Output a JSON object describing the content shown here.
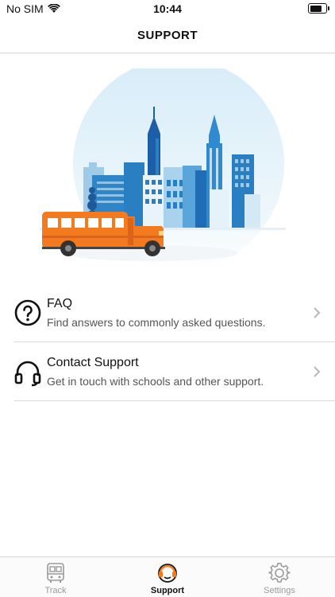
{
  "status_bar": {
    "carrier": "No SIM",
    "time": "10:44",
    "battery_level": 0.85
  },
  "nav": {
    "title": "SUPPORT"
  },
  "list": [
    {
      "title": "FAQ",
      "subtitle": "Find answers to commonly asked questions.",
      "icon": "question-circle-icon"
    },
    {
      "title": "Contact Support",
      "subtitle": "Get in touch with schools and other support.",
      "icon": "headset-icon"
    }
  ],
  "tabs": [
    {
      "label": "Track",
      "icon": "bus-icon",
      "active": false
    },
    {
      "label": "Support",
      "icon": "support-headset-icon",
      "active": true
    },
    {
      "label": "Settings",
      "icon": "gear-icon",
      "active": false
    }
  ],
  "colors": {
    "bus": "#f47a1f",
    "city_blue": "#2a7fc3",
    "accent_orange": "#f47a1f"
  }
}
